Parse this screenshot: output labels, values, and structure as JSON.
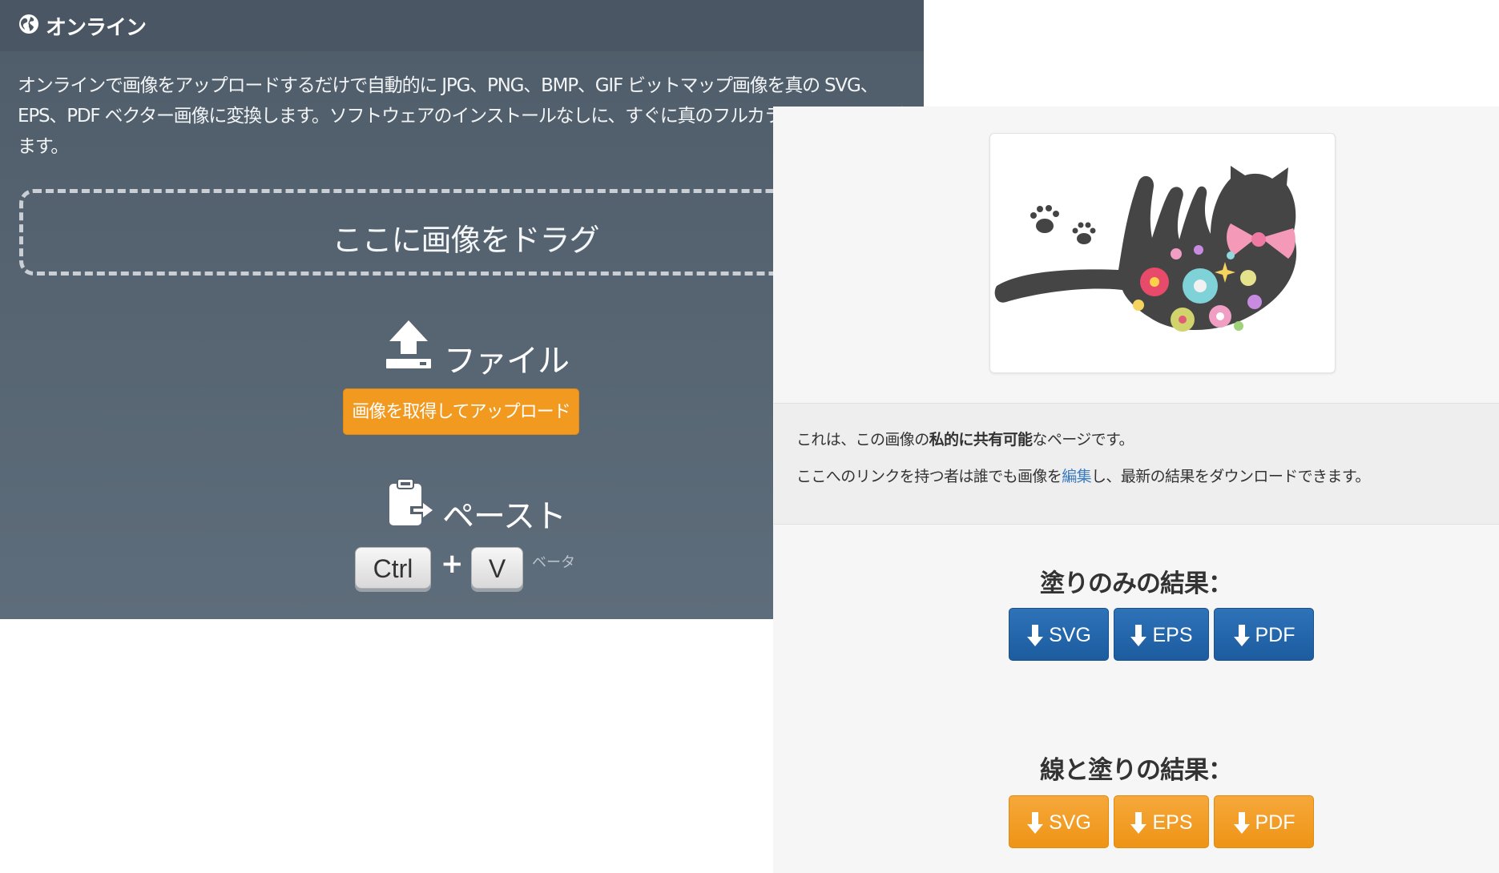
{
  "left": {
    "title": "オンライン",
    "description": "オンラインで画像をアップロードするだけで自動的に JPG、PNG、BMP、GIF ビットマップ画像を真の SVG、EPS、PDF ベクター画像に変換します。ソフトウェアのインストールなしに、すぐに真のフルカラートレーシング ます。",
    "drop_label": "ここに画像をドラグ",
    "file_label": "ファイル",
    "upload_button": "画像を取得してアップロード",
    "paste_label": "ペースト",
    "key_ctrl": "Ctrl",
    "key_plus": "+",
    "key_v": "V",
    "beta": "ベータ"
  },
  "right": {
    "info": {
      "line1_pre": "これは、この画像の",
      "line1_bold": "私的に共有可能",
      "line1_post": "なページです。",
      "line2_pre": "ここへのリンクを持つ者は誰でも画像を",
      "line2_link": "編集",
      "line2_post": "し、最新の結果をダウンロードできます。"
    },
    "fill_title": "塗りのみの結果：",
    "stroke_title": "線と塗りの結果：",
    "fill_buttons": [
      "SVG",
      "EPS",
      "PDF"
    ],
    "stroke_buttons": [
      "SVG",
      "EPS",
      "PDF"
    ]
  },
  "icons": {
    "globe": "globe-icon",
    "upload": "upload-icon",
    "clipboard": "clipboard-icon",
    "download": "download-arrow-icon"
  },
  "colors": {
    "left_bg": "#56636f",
    "orange": "#f19a1f",
    "blue": "#1f5fa3",
    "link": "#3a7bbf"
  }
}
